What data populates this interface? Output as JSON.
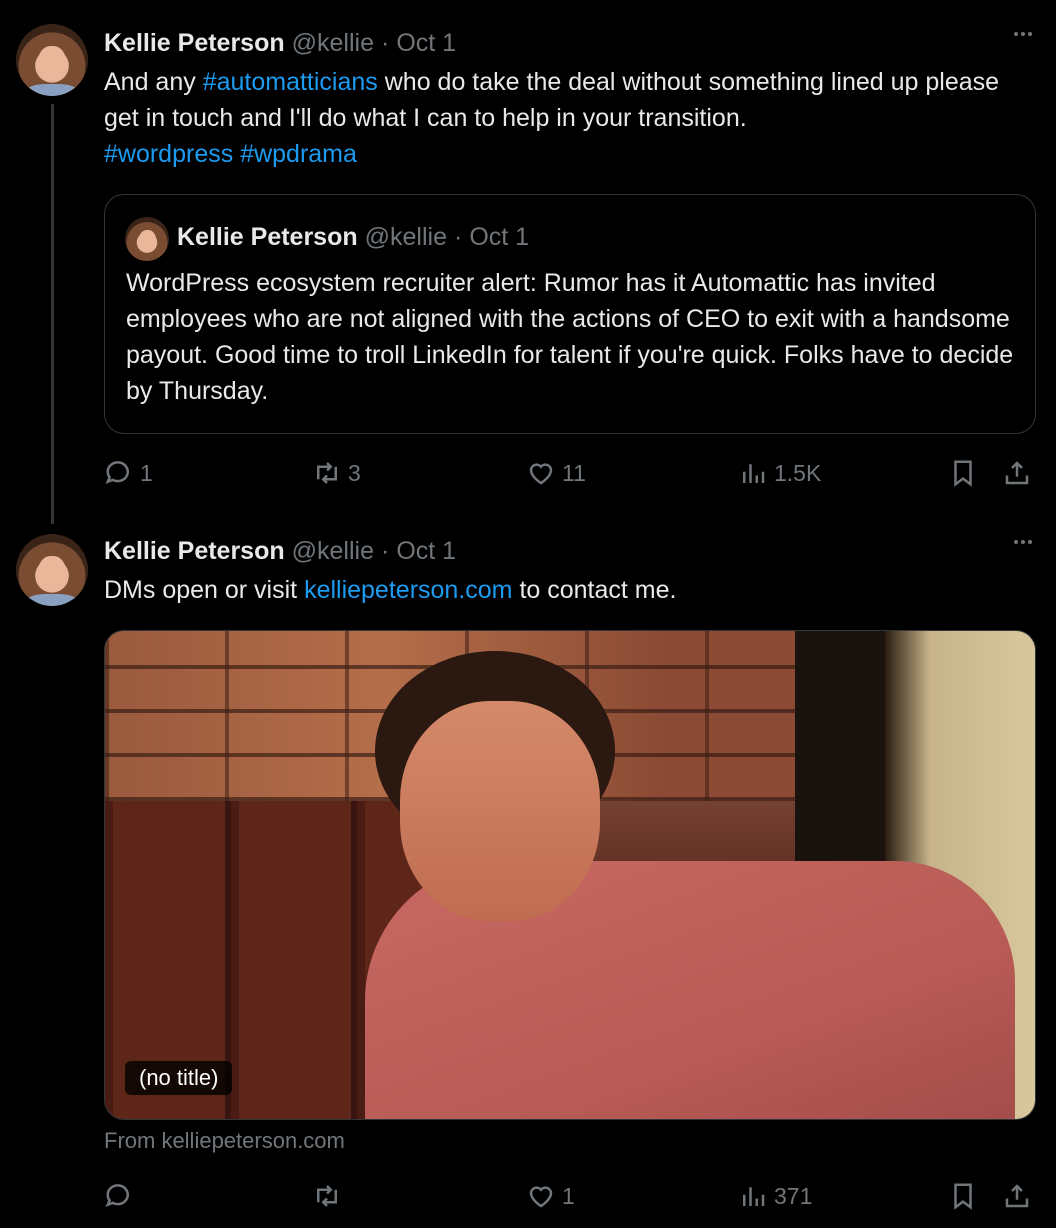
{
  "tweet1": {
    "name": "Kellie Peterson",
    "handle": "@kellie",
    "separator": "·",
    "date": "Oct 1",
    "text_pre": "And any ",
    "hashtag1": "#automatticians",
    "text_mid": " who do take the deal without something lined up please get in touch and I'll do what I can to help in your transition.",
    "hashtag2": "#wordpress",
    "hashtag3": "#wpdrama",
    "quote": {
      "name": "Kellie Peterson",
      "handle": "@kellie",
      "separator": "·",
      "date": "Oct 1",
      "text": "WordPress ecosystem recruiter alert: Rumor has it Automattic has invited employees who are not aligned with the actions of CEO to exit with a handsome payout. Good time to troll LinkedIn for talent if you're quick. Folks have to decide by Thursday."
    },
    "actions": {
      "replies": "1",
      "reposts": "3",
      "likes": "11",
      "views": "1.5K"
    }
  },
  "tweet2": {
    "name": "Kellie Peterson",
    "handle": "@kellie",
    "separator": "·",
    "date": "Oct 1",
    "text_pre": "DMs open or visit ",
    "link": "kelliepeterson.com",
    "text_post": " to contact me.",
    "card": {
      "label": "(no title)",
      "from": "From kelliepeterson.com"
    },
    "actions": {
      "replies": "",
      "reposts": "",
      "likes": "1",
      "views": "371"
    }
  },
  "icons": {
    "reply": "reply-icon",
    "repost": "repost-icon",
    "like": "heart-icon",
    "views": "views-icon",
    "bookmark": "bookmark-icon",
    "share": "share-icon",
    "more": "more-icon"
  },
  "colors": {
    "background": "#000000",
    "text": "#e7e9ea",
    "muted": "#71767b",
    "link": "#1d9bf0",
    "border": "#333639"
  }
}
